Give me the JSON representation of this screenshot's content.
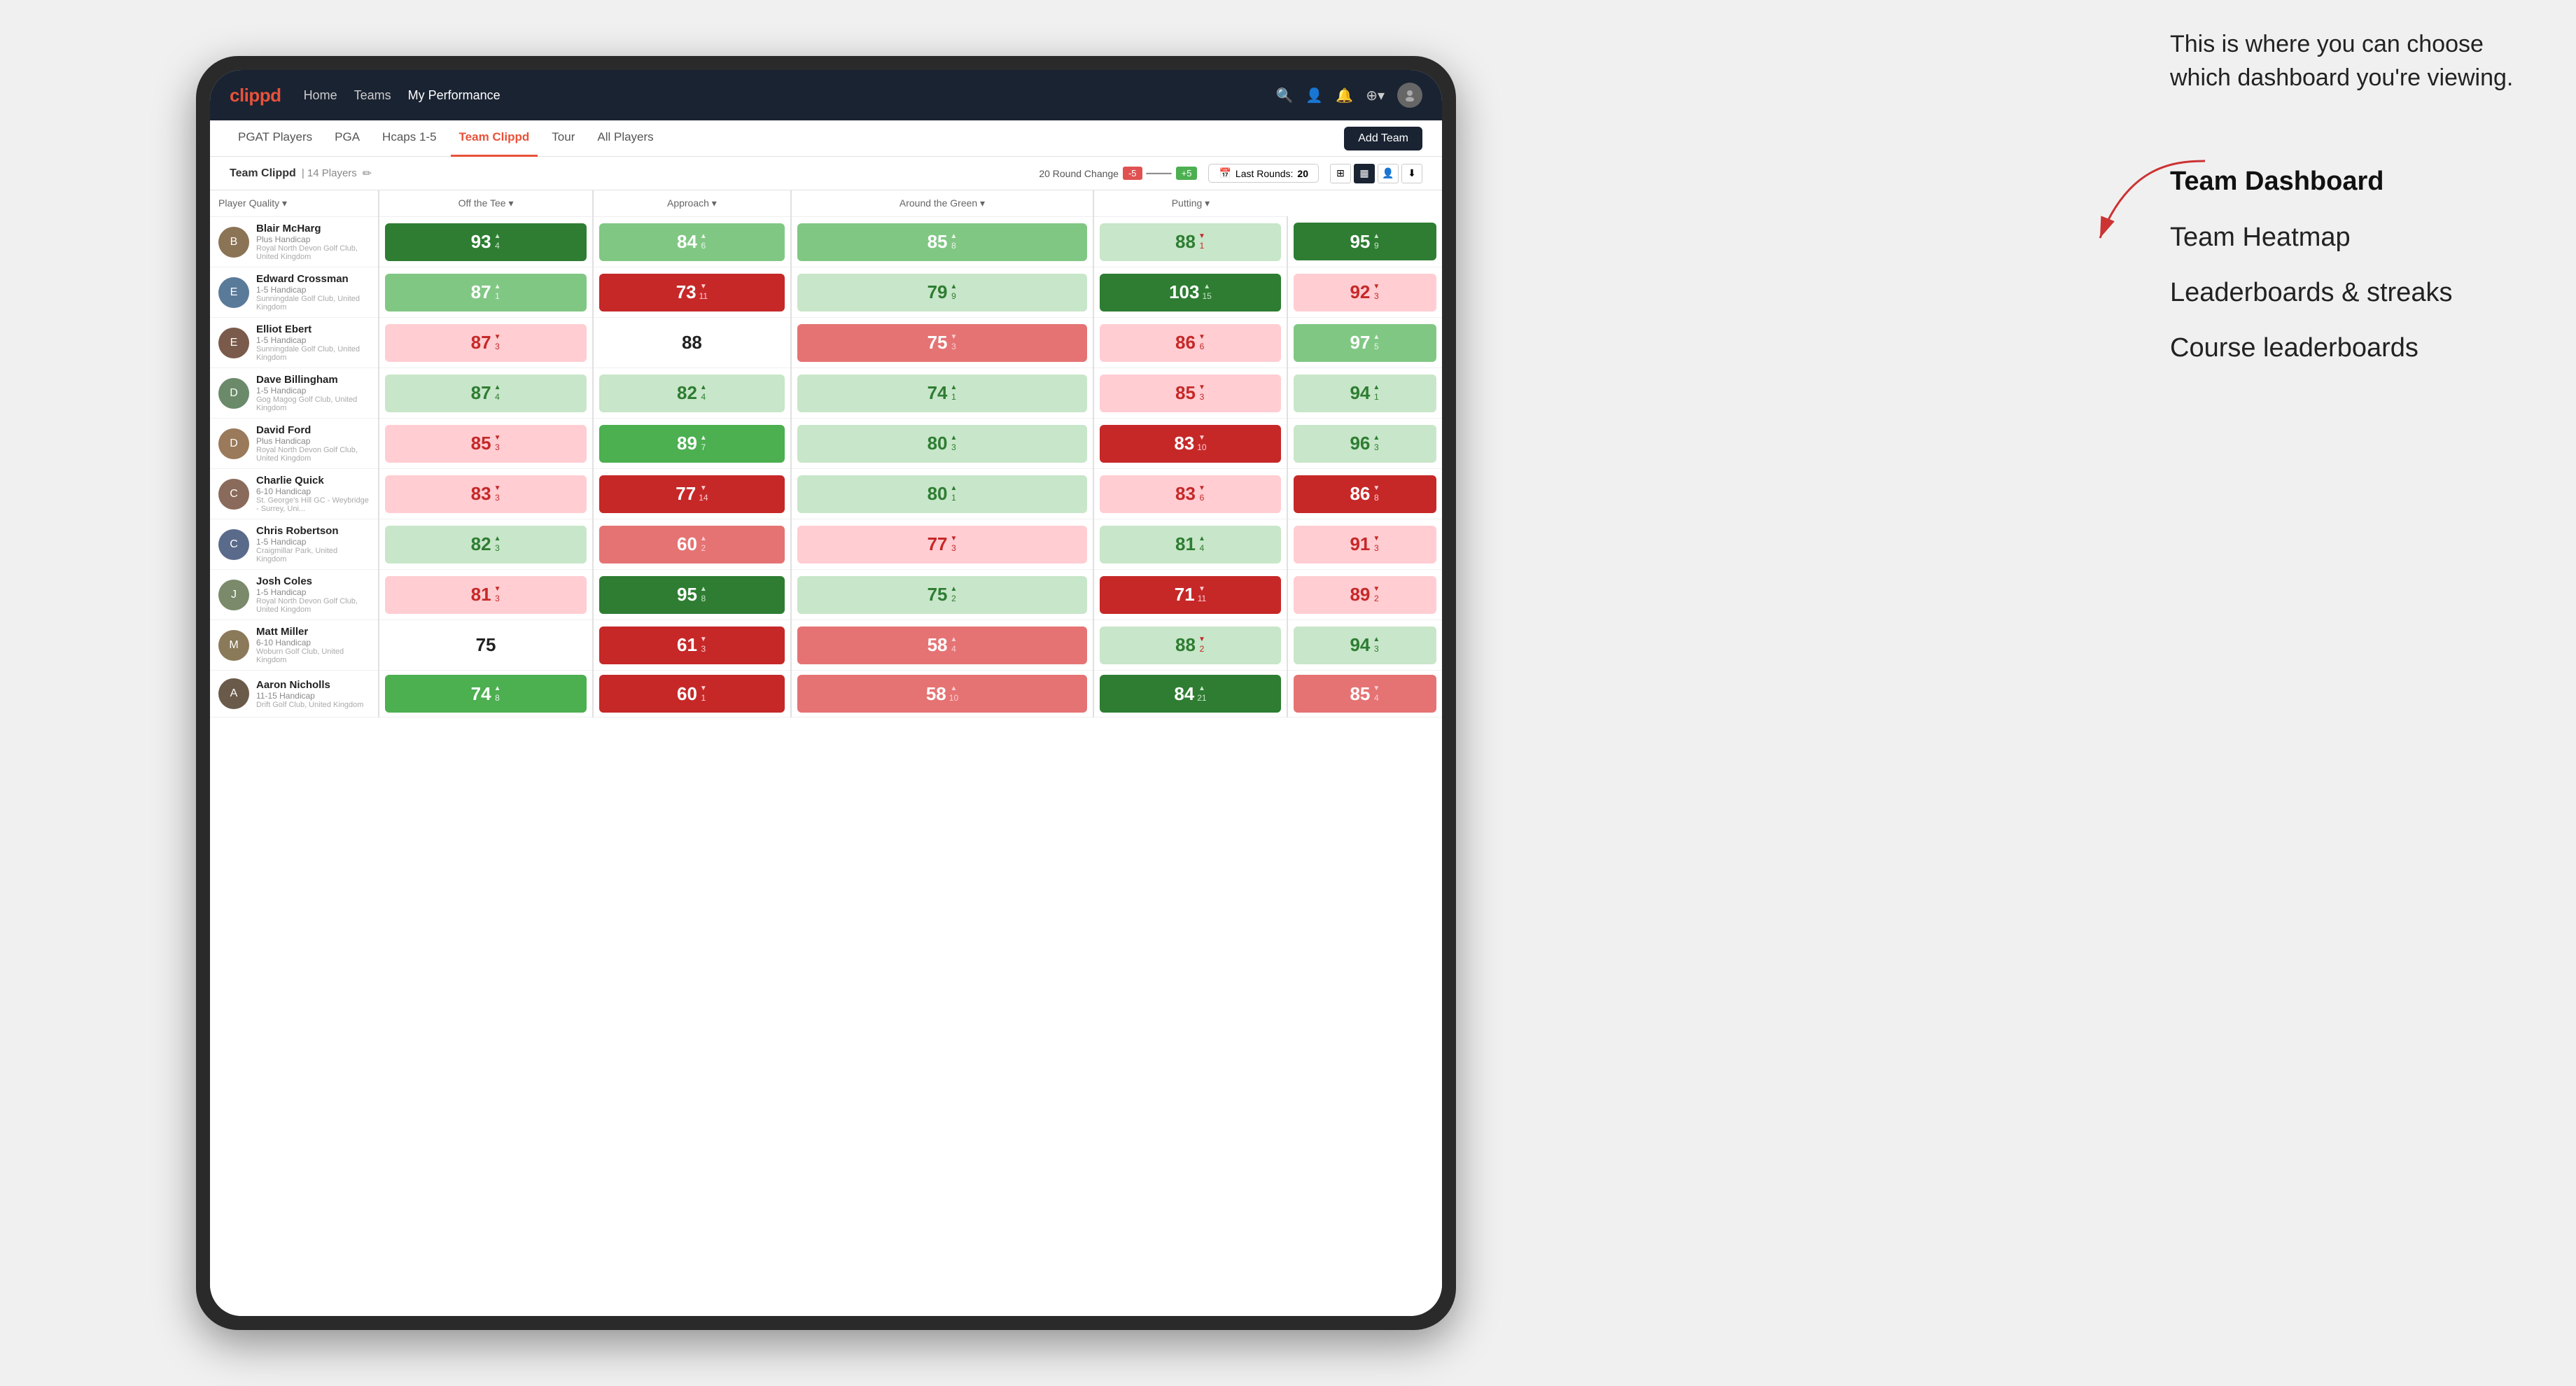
{
  "annotation": {
    "intro": "This is where you can choose which dashboard you're viewing.",
    "menu_items": [
      {
        "label": "Team Dashboard",
        "active": true
      },
      {
        "label": "Team Heatmap",
        "active": false
      },
      {
        "label": "Leaderboards & streaks",
        "active": false
      },
      {
        "label": "Course leaderboards",
        "active": false
      }
    ]
  },
  "navbar": {
    "logo": "clippd",
    "links": [
      "Home",
      "Teams",
      "My Performance"
    ],
    "active_link": "My Performance",
    "icons": [
      "🔍",
      "👤",
      "🔔",
      "⊕"
    ],
    "avatar_text": "👤"
  },
  "subnav": {
    "tabs": [
      "PGAT Players",
      "PGA",
      "Hcaps 1-5",
      "Team Clippd",
      "Tour",
      "All Players"
    ],
    "active_tab": "Team Clippd",
    "add_team_label": "Add Team"
  },
  "team_bar": {
    "name": "Team Clippd",
    "separator": "|",
    "count": "14 Players",
    "round_change_label": "20 Round Change",
    "badge_neg": "-5",
    "badge_pos": "+5",
    "last_rounds_label": "Last Rounds:",
    "last_rounds_value": "20",
    "views": [
      "grid",
      "heatmap",
      "person",
      "filter"
    ]
  },
  "table": {
    "headers": [
      {
        "label": "Player Quality ▾",
        "col": "player_quality"
      },
      {
        "label": "Off the Tee ▾",
        "col": "off_tee"
      },
      {
        "label": "Approach ▾",
        "col": "approach"
      },
      {
        "label": "Around the Green ▾",
        "col": "around_green"
      },
      {
        "label": "Putting ▾",
        "col": "putting"
      }
    ],
    "players": [
      {
        "name": "Blair McHarg",
        "handicap": "Plus Handicap",
        "club": "Royal North Devon Golf Club, United Kingdom",
        "avatar_color": "#8B7355",
        "player_quality": {
          "value": 93,
          "change": 4,
          "dir": "up",
          "bg": "bg-green-strong"
        },
        "off_tee": {
          "value": 84,
          "change": 6,
          "dir": "up",
          "bg": "bg-green-light"
        },
        "approach": {
          "value": 85,
          "change": 8,
          "dir": "up",
          "bg": "bg-green-light"
        },
        "around_green": {
          "value": 88,
          "change": 1,
          "dir": "down",
          "bg": "bg-green-pale"
        },
        "putting": {
          "value": 95,
          "change": 9,
          "dir": "up",
          "bg": "bg-green-strong"
        }
      },
      {
        "name": "Edward Crossman",
        "handicap": "1-5 Handicap",
        "club": "Sunningdale Golf Club, United Kingdom",
        "avatar_color": "#5a7a9a",
        "player_quality": {
          "value": 87,
          "change": 1,
          "dir": "up",
          "bg": "bg-green-light"
        },
        "off_tee": {
          "value": 73,
          "change": 11,
          "dir": "down",
          "bg": "bg-red-strong"
        },
        "approach": {
          "value": 79,
          "change": 9,
          "dir": "up",
          "bg": "bg-green-pale"
        },
        "around_green": {
          "value": 103,
          "change": 15,
          "dir": "up",
          "bg": "bg-green-strong"
        },
        "putting": {
          "value": 92,
          "change": 3,
          "dir": "down",
          "bg": "bg-red-pale"
        }
      },
      {
        "name": "Elliot Ebert",
        "handicap": "1-5 Handicap",
        "club": "Sunningdale Golf Club, United Kingdom",
        "avatar_color": "#7a5a4a",
        "player_quality": {
          "value": 87,
          "change": 3,
          "dir": "down",
          "bg": "bg-red-pale"
        },
        "off_tee": {
          "value": 88,
          "change": 0,
          "dir": "none",
          "bg": "bg-white"
        },
        "approach": {
          "value": 75,
          "change": 3,
          "dir": "down",
          "bg": "bg-red-med"
        },
        "around_green": {
          "value": 86,
          "change": 6,
          "dir": "down",
          "bg": "bg-red-pale"
        },
        "putting": {
          "value": 97,
          "change": 5,
          "dir": "up",
          "bg": "bg-green-light"
        }
      },
      {
        "name": "Dave Billingham",
        "handicap": "1-5 Handicap",
        "club": "Gog Magog Golf Club, United Kingdom",
        "avatar_color": "#6a8a6a",
        "player_quality": {
          "value": 87,
          "change": 4,
          "dir": "up",
          "bg": "bg-green-pale"
        },
        "off_tee": {
          "value": 82,
          "change": 4,
          "dir": "up",
          "bg": "bg-green-pale"
        },
        "approach": {
          "value": 74,
          "change": 1,
          "dir": "up",
          "bg": "bg-green-pale"
        },
        "around_green": {
          "value": 85,
          "change": 3,
          "dir": "down",
          "bg": "bg-red-pale"
        },
        "putting": {
          "value": 94,
          "change": 1,
          "dir": "up",
          "bg": "bg-green-pale"
        }
      },
      {
        "name": "David Ford",
        "handicap": "Plus Handicap",
        "club": "Royal North Devon Golf Club, United Kingdom",
        "avatar_color": "#9a7a5a",
        "player_quality": {
          "value": 85,
          "change": 3,
          "dir": "down",
          "bg": "bg-red-pale"
        },
        "off_tee": {
          "value": 89,
          "change": 7,
          "dir": "up",
          "bg": "bg-green-med"
        },
        "approach": {
          "value": 80,
          "change": 3,
          "dir": "up",
          "bg": "bg-green-pale"
        },
        "around_green": {
          "value": 83,
          "change": 10,
          "dir": "down",
          "bg": "bg-red-strong"
        },
        "putting": {
          "value": 96,
          "change": 3,
          "dir": "up",
          "bg": "bg-green-pale"
        }
      },
      {
        "name": "Charlie Quick",
        "handicap": "6-10 Handicap",
        "club": "St. George's Hill GC - Weybridge - Surrey, Uni...",
        "avatar_color": "#8a6a5a",
        "player_quality": {
          "value": 83,
          "change": 3,
          "dir": "down",
          "bg": "bg-red-pale"
        },
        "off_tee": {
          "value": 77,
          "change": 14,
          "dir": "down",
          "bg": "bg-red-strong"
        },
        "approach": {
          "value": 80,
          "change": 1,
          "dir": "up",
          "bg": "bg-green-pale"
        },
        "around_green": {
          "value": 83,
          "change": 6,
          "dir": "down",
          "bg": "bg-red-pale"
        },
        "putting": {
          "value": 86,
          "change": 8,
          "dir": "down",
          "bg": "bg-red-strong"
        }
      },
      {
        "name": "Chris Robertson",
        "handicap": "1-5 Handicap",
        "club": "Craigmillar Park, United Kingdom",
        "avatar_color": "#5a6a8a",
        "player_quality": {
          "value": 82,
          "change": 3,
          "dir": "up",
          "bg": "bg-green-pale"
        },
        "off_tee": {
          "value": 60,
          "change": 2,
          "dir": "up",
          "bg": "bg-red-med"
        },
        "approach": {
          "value": 77,
          "change": 3,
          "dir": "down",
          "bg": "bg-red-pale"
        },
        "around_green": {
          "value": 81,
          "change": 4,
          "dir": "up",
          "bg": "bg-green-pale"
        },
        "putting": {
          "value": 91,
          "change": 3,
          "dir": "down",
          "bg": "bg-red-pale"
        }
      },
      {
        "name": "Josh Coles",
        "handicap": "1-5 Handicap",
        "club": "Royal North Devon Golf Club, United Kingdom",
        "avatar_color": "#7a8a6a",
        "player_quality": {
          "value": 81,
          "change": 3,
          "dir": "down",
          "bg": "bg-red-pale"
        },
        "off_tee": {
          "value": 95,
          "change": 8,
          "dir": "up",
          "bg": "bg-green-strong"
        },
        "approach": {
          "value": 75,
          "change": 2,
          "dir": "up",
          "bg": "bg-green-pale"
        },
        "around_green": {
          "value": 71,
          "change": 11,
          "dir": "down",
          "bg": "bg-red-strong"
        },
        "putting": {
          "value": 89,
          "change": 2,
          "dir": "down",
          "bg": "bg-red-pale"
        }
      },
      {
        "name": "Matt Miller",
        "handicap": "6-10 Handicap",
        "club": "Woburn Golf Club, United Kingdom",
        "avatar_color": "#8a7a5a",
        "player_quality": {
          "value": 75,
          "change": 0,
          "dir": "none",
          "bg": "bg-white"
        },
        "off_tee": {
          "value": 61,
          "change": 3,
          "dir": "down",
          "bg": "bg-red-strong"
        },
        "approach": {
          "value": 58,
          "change": 4,
          "dir": "up",
          "bg": "bg-red-med"
        },
        "around_green": {
          "value": 88,
          "change": 2,
          "dir": "down",
          "bg": "bg-green-pale"
        },
        "putting": {
          "value": 94,
          "change": 3,
          "dir": "up",
          "bg": "bg-green-pale"
        }
      },
      {
        "name": "Aaron Nicholls",
        "handicap": "11-15 Handicap",
        "club": "Drift Golf Club, United Kingdom",
        "avatar_color": "#6a5a4a",
        "player_quality": {
          "value": 74,
          "change": 8,
          "dir": "up",
          "bg": "bg-green-med"
        },
        "off_tee": {
          "value": 60,
          "change": 1,
          "dir": "down",
          "bg": "bg-red-strong"
        },
        "approach": {
          "value": 58,
          "change": 10,
          "dir": "up",
          "bg": "bg-red-med"
        },
        "around_green": {
          "value": 84,
          "change": 21,
          "dir": "up",
          "bg": "bg-green-strong"
        },
        "putting": {
          "value": 85,
          "change": 4,
          "dir": "down",
          "bg": "bg-red-med"
        }
      }
    ]
  }
}
